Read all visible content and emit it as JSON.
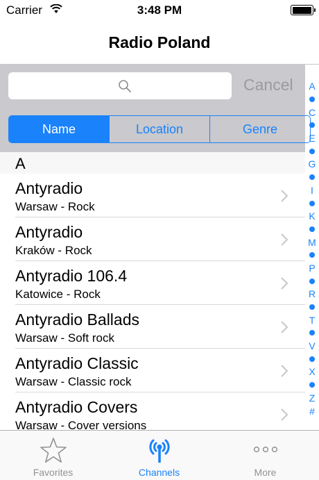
{
  "status_bar": {
    "carrier": "Carrier",
    "time": "3:48 PM"
  },
  "nav": {
    "title": "Radio Poland"
  },
  "search": {
    "placeholder": "",
    "cancel_label": "Cancel"
  },
  "segments": [
    {
      "label": "Name",
      "selected": true
    },
    {
      "label": "Location",
      "selected": false
    },
    {
      "label": "Genre",
      "selected": false
    }
  ],
  "section": {
    "letter": "A"
  },
  "stations": [
    {
      "name": "Antyradio",
      "subtitle": "Warsaw - Rock"
    },
    {
      "name": "Antyradio",
      "subtitle": "Kraków - Rock"
    },
    {
      "name": "Antyradio 106.4",
      "subtitle": "Katowice - Rock"
    },
    {
      "name": "Antyradio Ballads",
      "subtitle": "Warsaw - Soft rock"
    },
    {
      "name": "Antyradio Classic",
      "subtitle": "Warsaw - Classic rock"
    },
    {
      "name": "Antyradio Covers",
      "subtitle": "Warsaw - Cover versions"
    }
  ],
  "index": [
    "A",
    "•",
    "C",
    "•",
    "E",
    "•",
    "G",
    "•",
    "I",
    "•",
    "K",
    "•",
    "M",
    "•",
    "P",
    "•",
    "R",
    "•",
    "T",
    "•",
    "V",
    "•",
    "X",
    "•",
    "Z",
    "#"
  ],
  "tabs": [
    {
      "label": "Favorites",
      "icon": "star-icon",
      "active": false
    },
    {
      "label": "Channels",
      "icon": "antenna-icon",
      "active": true
    },
    {
      "label": "More",
      "icon": "more-dots-icon",
      "active": false
    }
  ],
  "colors": {
    "accent": "#1a82fb",
    "search_bg": "#c9c9ce",
    "inactive_tab": "#929292"
  }
}
